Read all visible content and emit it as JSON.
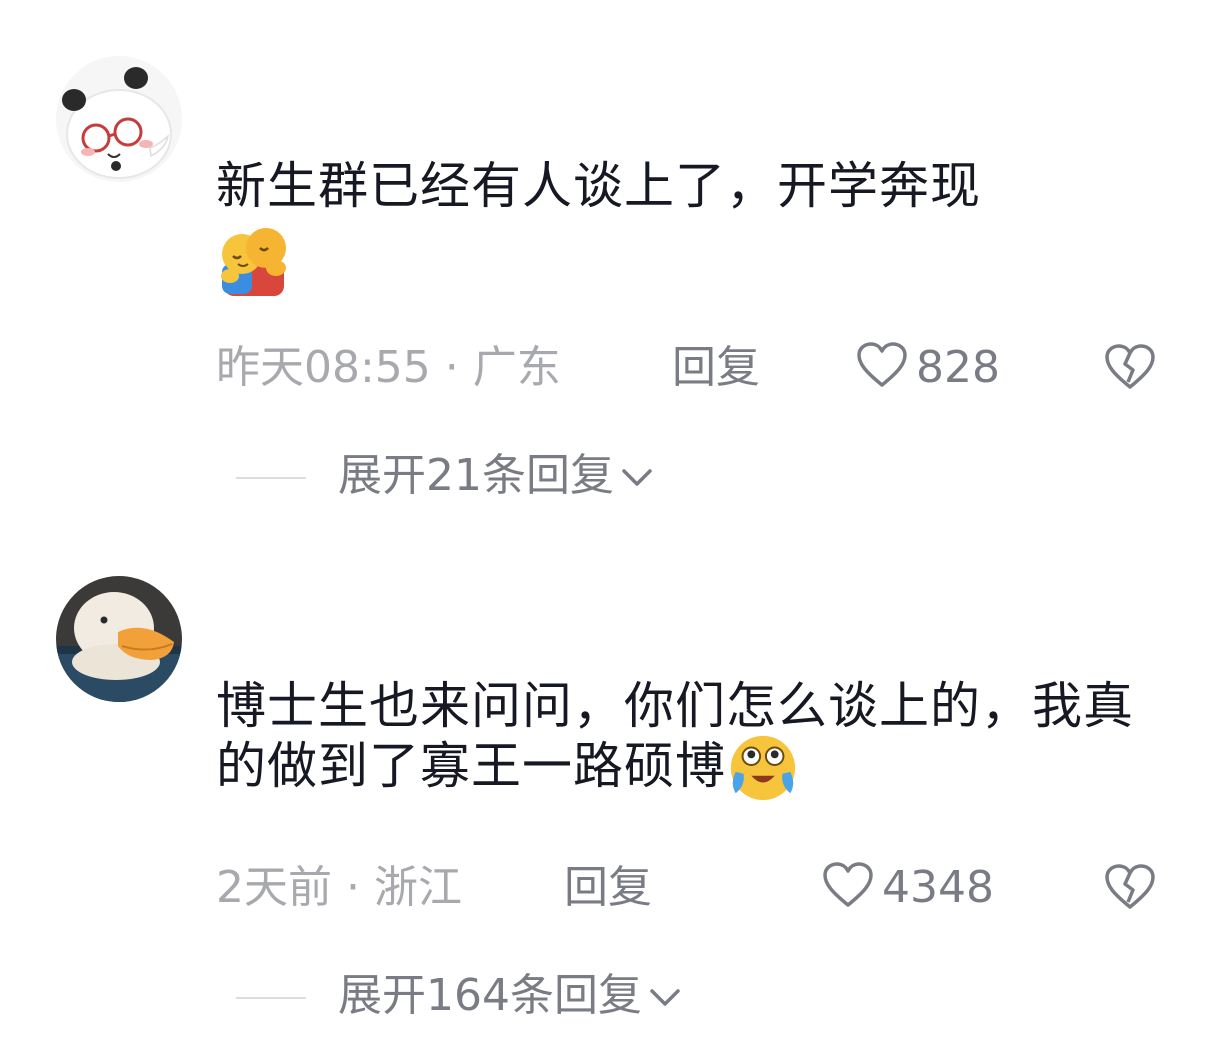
{
  "comments": [
    {
      "avatar_icon": "panda-glasses-avatar-icon",
      "text": "新生群已经有人谈上了，开学奔现",
      "emoji_icon": "hug-emoji-icon",
      "time": "昨天08:55 · 广东",
      "reply_label": "回复",
      "like_count": "828",
      "expand_label": "展开21条回复"
    },
    {
      "avatar_icon": "duck-avatar-icon",
      "text": "博士生也来问问，你们怎么谈上的，我真的做到了寡王一路硕博",
      "emoji_icon": "crying-laughing-emoji-icon",
      "time": "2天前 · 浙江",
      "reply_label": "回复",
      "like_count": "4348",
      "expand_label": "展开164条回复"
    }
  ],
  "colors": {
    "text": "#161823",
    "meta": "#a8a9ae",
    "action": "#7a7c85"
  }
}
